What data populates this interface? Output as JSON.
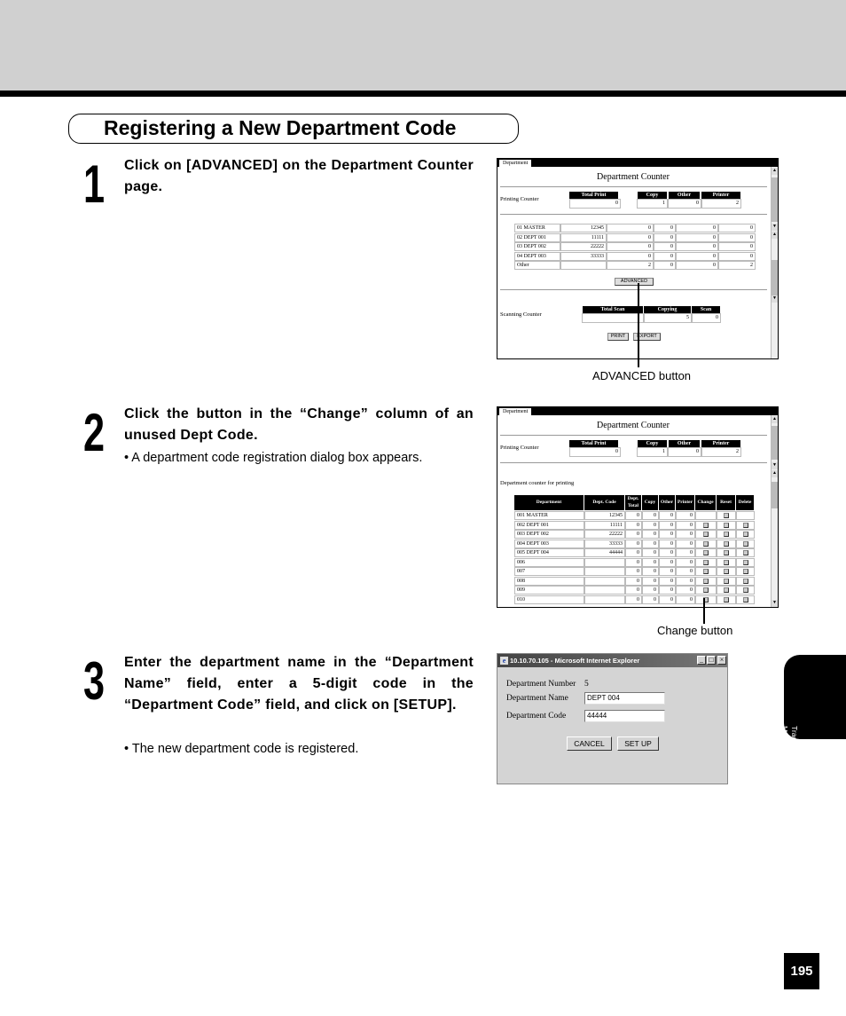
{
  "section_title": "Registering a New Department Code",
  "steps": [
    {
      "number": "1",
      "text": "Click on [ADVANCED] on the Department Counter page.",
      "note": ""
    },
    {
      "number": "2",
      "text": "Click the button in the “Change” column of an unused Dept Code.",
      "note": "• A department code registration dialog box appears."
    },
    {
      "number": "3",
      "text": "Enter the department name in the “Department Name” field, enter a 5-digit code in the “Department Code” field, and click on [SETUP].",
      "note": "• The new department code is registered."
    }
  ],
  "screenshot1": {
    "tab": "Department",
    "title": "Department Counter",
    "printing_label": "Printing Counter",
    "total_print_header": "Total Print",
    "total_print_value": "0",
    "copy_header": "Copy",
    "other_header": "Other",
    "printer_header": "Printer",
    "copy_value": "1",
    "other_value": "0",
    "printer_value": "2",
    "rows": [
      [
        "01 MASTER",
        "12345",
        "0",
        "0",
        "0",
        "0"
      ],
      [
        "02 DEPT 001",
        "11111",
        "0",
        "0",
        "0",
        "0"
      ],
      [
        "03 DEPT 002",
        "22222",
        "0",
        "0",
        "0",
        "0"
      ],
      [
        "04 DEPT 003",
        "33333",
        "0",
        "0",
        "0",
        "0"
      ],
      [
        "Other",
        "",
        "2",
        "0",
        "0",
        "2"
      ]
    ],
    "advanced_button": "ADVANCED",
    "scanning_label": "Scanning Counter",
    "total_scan_header": "Total Scan",
    "copying_header": "Copying",
    "scan_header": "Scan",
    "total_scan_value": "",
    "copying_value": "5",
    "scan_value": "0",
    "print_button": "PRINT",
    "export_button": "EXPORT",
    "callout": "ADVANCED button"
  },
  "screenshot2": {
    "tab": "Department",
    "title": "Department Counter",
    "printing_label": "Printing Counter",
    "total_print_header": "Total Print",
    "total_print_value": "0",
    "copy_header": "Copy",
    "other_header": "Other",
    "printer_header": "Printer",
    "copy_value": "1",
    "other_value": "0",
    "printer_value": "2",
    "subheading": "Department counter for printing",
    "columns": [
      "Department",
      "Dept. Code",
      "Dept. Total",
      "Copy",
      "Other",
      "Printer",
      "Change",
      "Reset",
      "Delete"
    ],
    "rows": [
      [
        "001  MASTER",
        "12345",
        "0",
        "0",
        "0",
        "0"
      ],
      [
        "002  DEPT 001",
        "11111",
        "0",
        "0",
        "0",
        "0"
      ],
      [
        "003  DEPT 002",
        "22222",
        "0",
        "0",
        "0",
        "0"
      ],
      [
        "004  DEPT 003",
        "33333",
        "0",
        "0",
        "0",
        "0"
      ],
      [
        "005  DEPT 004",
        "44444",
        "0",
        "0",
        "0",
        "0"
      ],
      [
        "006",
        "",
        "0",
        "0",
        "0",
        "0"
      ],
      [
        "007",
        "",
        "0",
        "0",
        "0",
        "0"
      ],
      [
        "008",
        "",
        "0",
        "0",
        "0",
        "0"
      ],
      [
        "009",
        "",
        "0",
        "0",
        "0",
        "0"
      ],
      [
        "010",
        "",
        "0",
        "0",
        "0",
        "0"
      ]
    ],
    "callout": "Change button"
  },
  "dialog": {
    "title": "10.10.70.105 - Microsoft Internet Explorer",
    "dept_number_label": "Department Number",
    "dept_number_value": "5",
    "dept_name_label": "Department Name",
    "dept_name_value": "DEPT 004",
    "dept_code_label": "Department Code",
    "dept_code_value": "44444",
    "cancel_button": "CANCEL",
    "setup_button": "SET UP"
  },
  "side_tab": "Tracking and Managing Print Jobs",
  "page_number": "195"
}
